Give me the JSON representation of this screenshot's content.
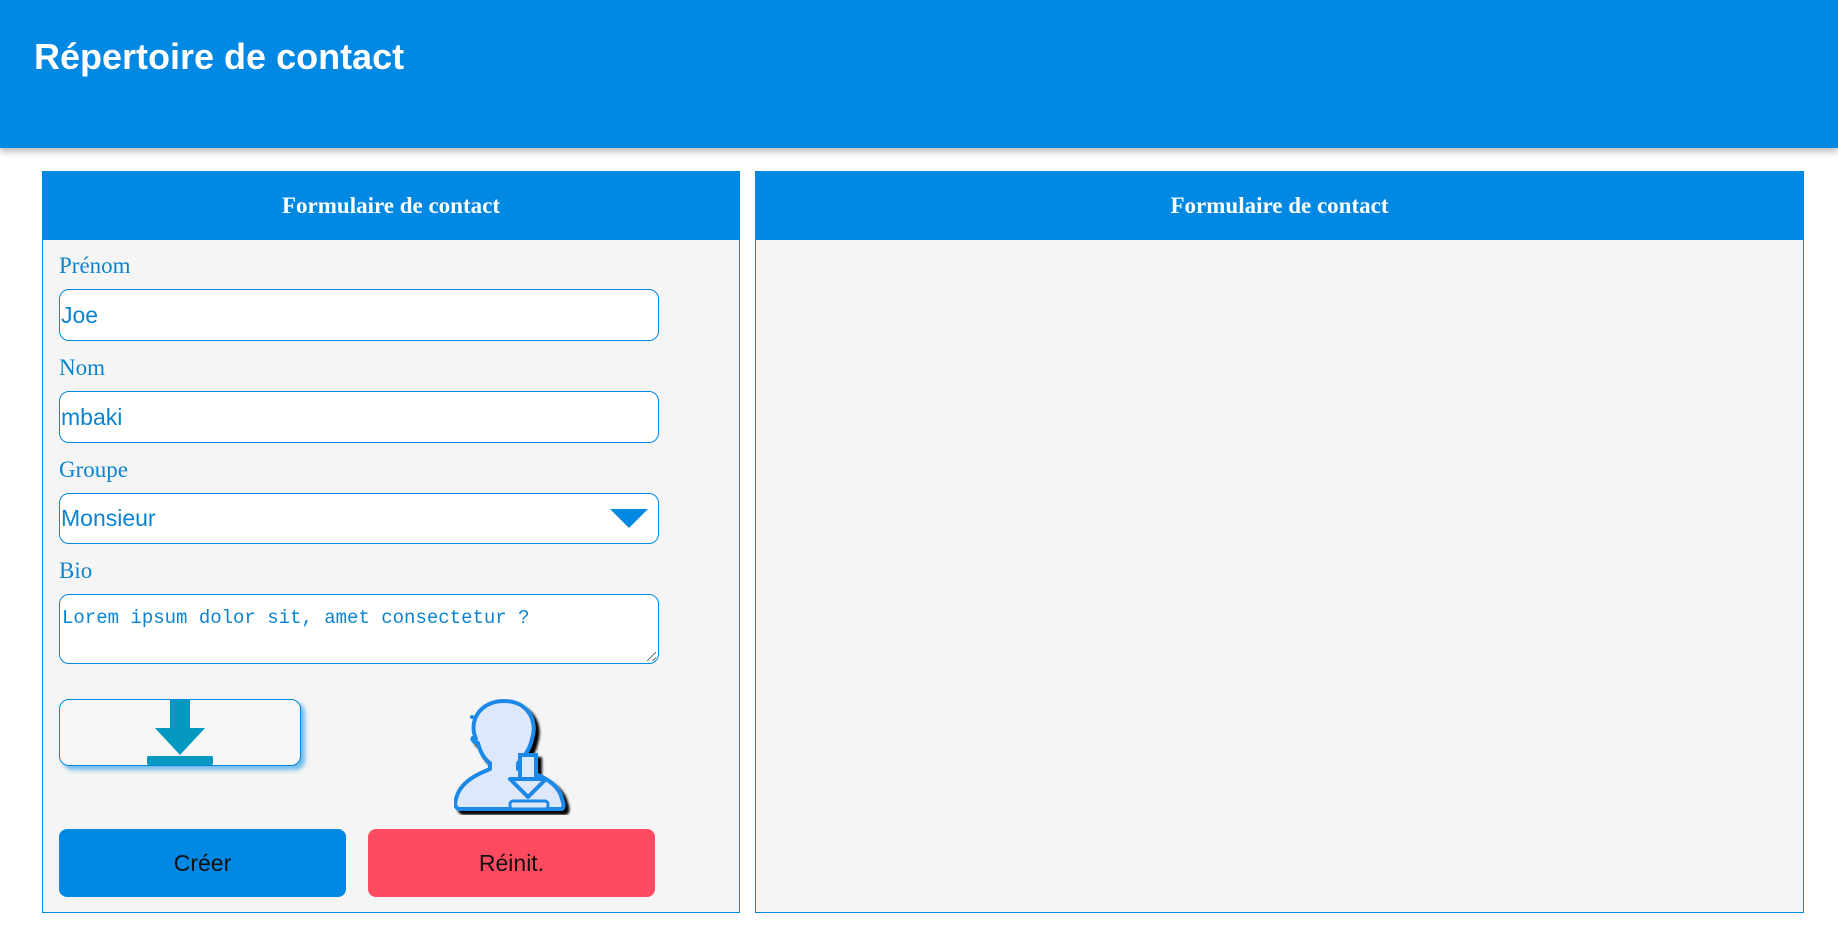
{
  "app": {
    "title": "Répertoire de contact"
  },
  "form_panel": {
    "header": "Formulaire de contact",
    "fields": {
      "first_name": {
        "label": "Prénom",
        "value": "Joe"
      },
      "last_name": {
        "label": "Nom",
        "value": "mbaki"
      },
      "group": {
        "label": "Groupe",
        "selected": "Monsieur"
      },
      "bio": {
        "label": "Bio",
        "value": "Lorem ipsum dolor sit, amet consectetur ?"
      }
    },
    "buttons": {
      "create": "Créer",
      "reset": "Réinit."
    }
  },
  "list_panel": {
    "header": "Formulaire de contact"
  },
  "icons": {
    "download": "download-icon",
    "user_import": "user-import-icon"
  },
  "colors": {
    "primary": "#0088e2",
    "danger": "#ff4b5f",
    "label": "#0a84d0",
    "panel_bg": "#f5f5f5",
    "download_icon": "#0598c0"
  }
}
